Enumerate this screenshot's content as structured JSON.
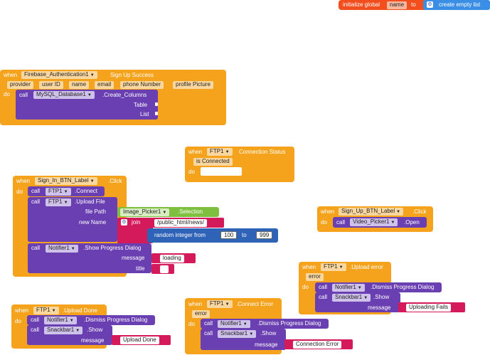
{
  "global": {
    "init_label": "initialize global",
    "var_name": "name",
    "to_label": "to",
    "create_empty_list": "create empty list"
  },
  "signup_success": {
    "when": "when",
    "component": "Firebase_Authentication1",
    "event": "Sign Up Success",
    "params": [
      "provider",
      "user ID",
      "name",
      "email",
      "phone Number",
      "profile Picture"
    ],
    "do": "do",
    "call": "call",
    "target": "MySQL_Database1",
    "method": ".Create_Columns",
    "arg_table": "Table",
    "arg_list": "List"
  },
  "ftp_conn_status": {
    "when": "when",
    "component": "FTP1",
    "event": "Connection Status",
    "param": "is Connected",
    "do": "do"
  },
  "signin_click": {
    "when": "when",
    "component": "Sign_In_BTN_Label",
    "event": ".Click",
    "do": "do",
    "call": "call",
    "ftp": "FTP1",
    "connect": ".Connect",
    "upload_file": ".Upload File",
    "file_path_label": "file Path",
    "image_picker": "Image_Picker1",
    "selection": ".Selection",
    "new_name_label": "new Name",
    "join": "join",
    "path_text": "/public_html/news/",
    "random_label": "random integer from",
    "random_from": "100",
    "random_to_label": "to",
    "random_to": "999",
    "notifier": "Notifier1",
    "show_progress": ".Show Progress Dialog",
    "message_label": "message",
    "message_val": "loading",
    "title_label": "title",
    "title_val": " "
  },
  "signup_click": {
    "when": "when",
    "component": "Sign_Up_BTN_Label",
    "event": ".Click",
    "do": "do",
    "call": "call",
    "target": "Video_Picker1",
    "method": ".Open"
  },
  "upload_error": {
    "when": "when",
    "component": "FTP1",
    "event": ".Upload error",
    "param": "error",
    "do": "do",
    "call": "call",
    "notifier": "Notifier1",
    "dismiss": ".Dismiss Progress Dialog",
    "snackbar": "Snackbar1",
    "show": ".Show",
    "message_label": "message",
    "message_val": "Uploading Fails"
  },
  "upload_done": {
    "when": "when",
    "component": "FTP1",
    "event": ".Upload Done",
    "do": "do",
    "call": "call",
    "notifier": "Notifier1",
    "dismiss": ".Dismiss Progress Dialog",
    "snackbar": "Snackbar1",
    "show": ".Show",
    "message_label": "message",
    "message_val": "Upload Done"
  },
  "connect_error": {
    "when": "when",
    "component": "FTP1",
    "event": ".Connect Error",
    "param": "error",
    "do": "do",
    "call": "call",
    "notifier": "Notifier1",
    "dismiss": ".Dismiss Progress Dialog",
    "snackbar": "Snackbar1",
    "show": ".Show",
    "message_label": "message",
    "message_val": "Connection Error"
  }
}
